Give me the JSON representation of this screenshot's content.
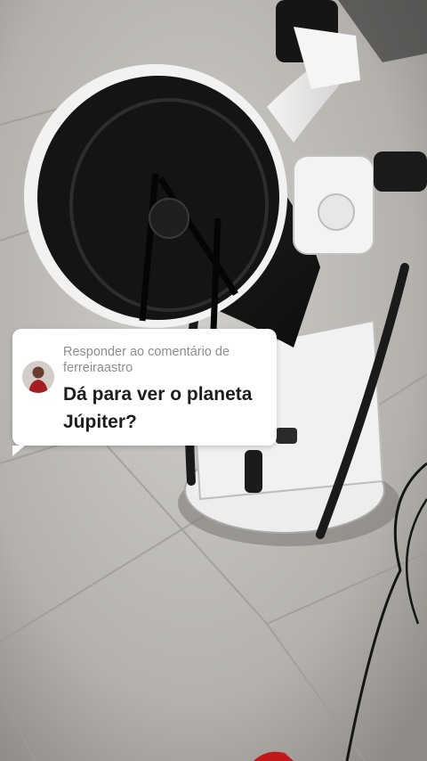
{
  "reply_card": {
    "reply_prefix": "Responder ao comentário de",
    "username": "ferreiraastro",
    "comment": "Dá para ver o planeta Júpiter?"
  },
  "icons": {
    "avatar": "profile-avatar"
  }
}
